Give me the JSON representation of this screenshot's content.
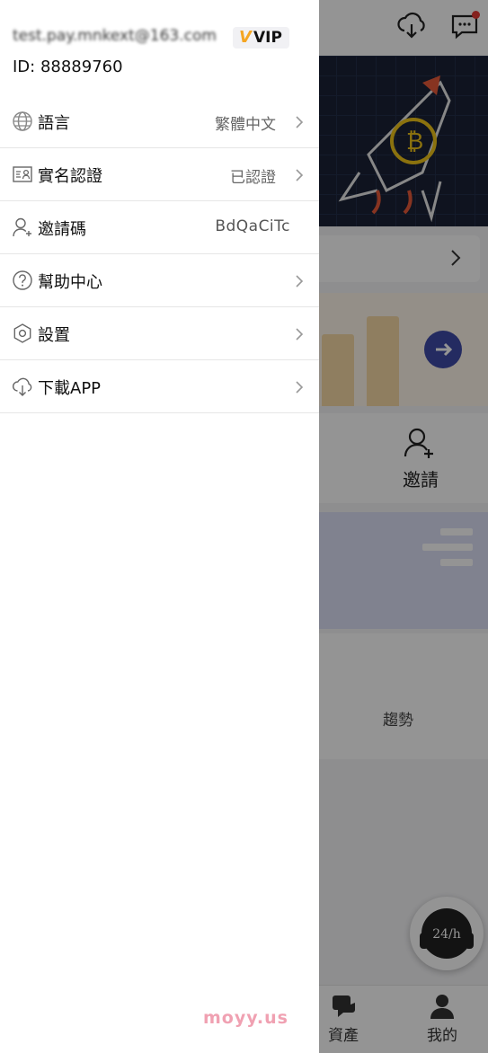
{
  "drawer": {
    "email": "test.pay.mnkext@163.com",
    "vip_badge": "VIP",
    "user_id": "ID: 88889760",
    "menu": [
      {
        "label": "語言",
        "value": "繁體中文",
        "icon": "globe-icon",
        "chevron": true
      },
      {
        "label": "實名認證",
        "value": "已認證",
        "icon": "id-card-icon",
        "chevron": true
      },
      {
        "label": "邀請碼",
        "value": "BdQaCiTc",
        "icon": "user-add-icon",
        "chevron": false
      },
      {
        "label": "幫助中心",
        "value": "",
        "icon": "question-icon",
        "chevron": true
      },
      {
        "label": "設置",
        "value": "",
        "icon": "hexagon-settings-icon",
        "chevron": true
      },
      {
        "label": "下載APP",
        "value": "",
        "icon": "cloud-download-icon",
        "chevron": true
      }
    ]
  },
  "background": {
    "quick_action": "邀請",
    "trend_label": "趨勢",
    "bottom_nav": [
      {
        "label": "資產",
        "icon": "assets-icon"
      },
      {
        "label": "我的",
        "icon": "profile-icon"
      }
    ],
    "support_badge": "24/h"
  },
  "watermark": "moyy.us",
  "colors": {
    "vip_accent": "#f5a623",
    "notification_dot": "#e53935",
    "overlay": "rgba(0,0,0,0.42)",
    "promo_button": "#3f4aa8",
    "watermark": "#f0a1b2"
  }
}
